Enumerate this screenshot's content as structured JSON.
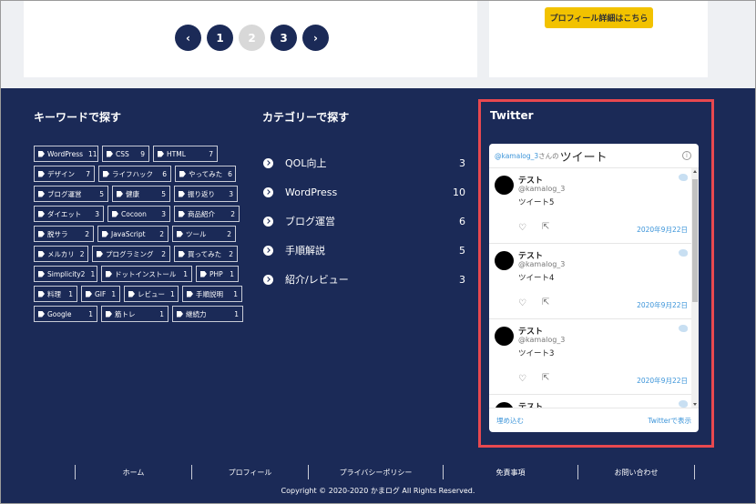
{
  "pagination": {
    "prev": "‹",
    "pages": [
      "1",
      "2",
      "3"
    ],
    "current": "2",
    "next": "›"
  },
  "profile_button": "プロフィール詳細はこちら",
  "keywords": {
    "title": "キーワードで探す",
    "rows": [
      [
        {
          "label": "WordPress",
          "count": "11"
        },
        {
          "label": "CSS",
          "count": "9"
        },
        {
          "label": "HTML",
          "count": "7"
        }
      ],
      [
        {
          "label": "デザイン",
          "count": "7"
        },
        {
          "label": "ライフハック",
          "count": "6"
        },
        {
          "label": "やってみた",
          "count": "6"
        }
      ],
      [
        {
          "label": "ブログ運営",
          "count": "5"
        },
        {
          "label": "健康",
          "count": "5"
        },
        {
          "label": "振り返り",
          "count": "3"
        }
      ],
      [
        {
          "label": "ダイエット",
          "count": "3"
        },
        {
          "label": "Cocoon",
          "count": "3"
        },
        {
          "label": "商品紹介",
          "count": "2"
        }
      ],
      [
        {
          "label": "脱サラ",
          "count": "2"
        },
        {
          "label": "JavaScript",
          "count": "2"
        },
        {
          "label": "ツール",
          "count": "2"
        }
      ],
      [
        {
          "label": "メルカリ",
          "count": "2"
        },
        {
          "label": "プログラミング",
          "count": "2"
        },
        {
          "label": "買ってみた",
          "count": "2"
        }
      ],
      [
        {
          "label": "Simplicity2",
          "count": "1"
        },
        {
          "label": "ドットインストール",
          "count": "1"
        },
        {
          "label": "PHP",
          "count": "1"
        }
      ],
      [
        {
          "label": "料理",
          "count": "1"
        },
        {
          "label": "GIF",
          "count": "1"
        },
        {
          "label": "レビュー",
          "count": "1"
        },
        {
          "label": "手順説明",
          "count": "1"
        }
      ],
      [
        {
          "label": "Google",
          "count": "1"
        },
        {
          "label": "筋トレ",
          "count": "1"
        },
        {
          "label": "継続力",
          "count": "1"
        }
      ]
    ]
  },
  "categories": {
    "title": "カテゴリーで探す",
    "items": [
      {
        "label": "QOL向上",
        "count": "3"
      },
      {
        "label": "WordPress",
        "count": "10"
      },
      {
        "label": "ブログ運営",
        "count": "6"
      },
      {
        "label": "手順解説",
        "count": "5"
      },
      {
        "label": "紹介/レビュー",
        "count": "3"
      }
    ]
  },
  "twitter": {
    "title": "Twitter",
    "handle": "@kamalog_3",
    "san": "さんの",
    "header": "ツイート",
    "info": "i",
    "tweets": [
      {
        "name": "テスト",
        "user": "@kamalog_3",
        "text": "ツイート5",
        "date": "2020年9月22日"
      },
      {
        "name": "テスト",
        "user": "@kamalog_3",
        "text": "ツイート4",
        "date": "2020年9月22日"
      },
      {
        "name": "テスト",
        "user": "@kamalog_3",
        "text": "ツイート3",
        "date": "2020年9月22日"
      },
      {
        "name": "テスト",
        "user": "",
        "text": "",
        "date": ""
      }
    ],
    "embed": "埋め込む",
    "view": "Twitterで表示",
    "heart": "♡",
    "share": "⇱"
  },
  "footer": {
    "nav": [
      "ホーム",
      "プロフィール",
      "プライバシーポリシー",
      "免責事項",
      "お問い合わせ"
    ],
    "copyright": "Copyright © 2020-2020 かまログ All Rights Reserved."
  },
  "colors": {
    "navy": "#1b2a57",
    "highlight": "#e8484f",
    "button_yellow": "#f2c200",
    "link_blue": "#3b94d9"
  }
}
